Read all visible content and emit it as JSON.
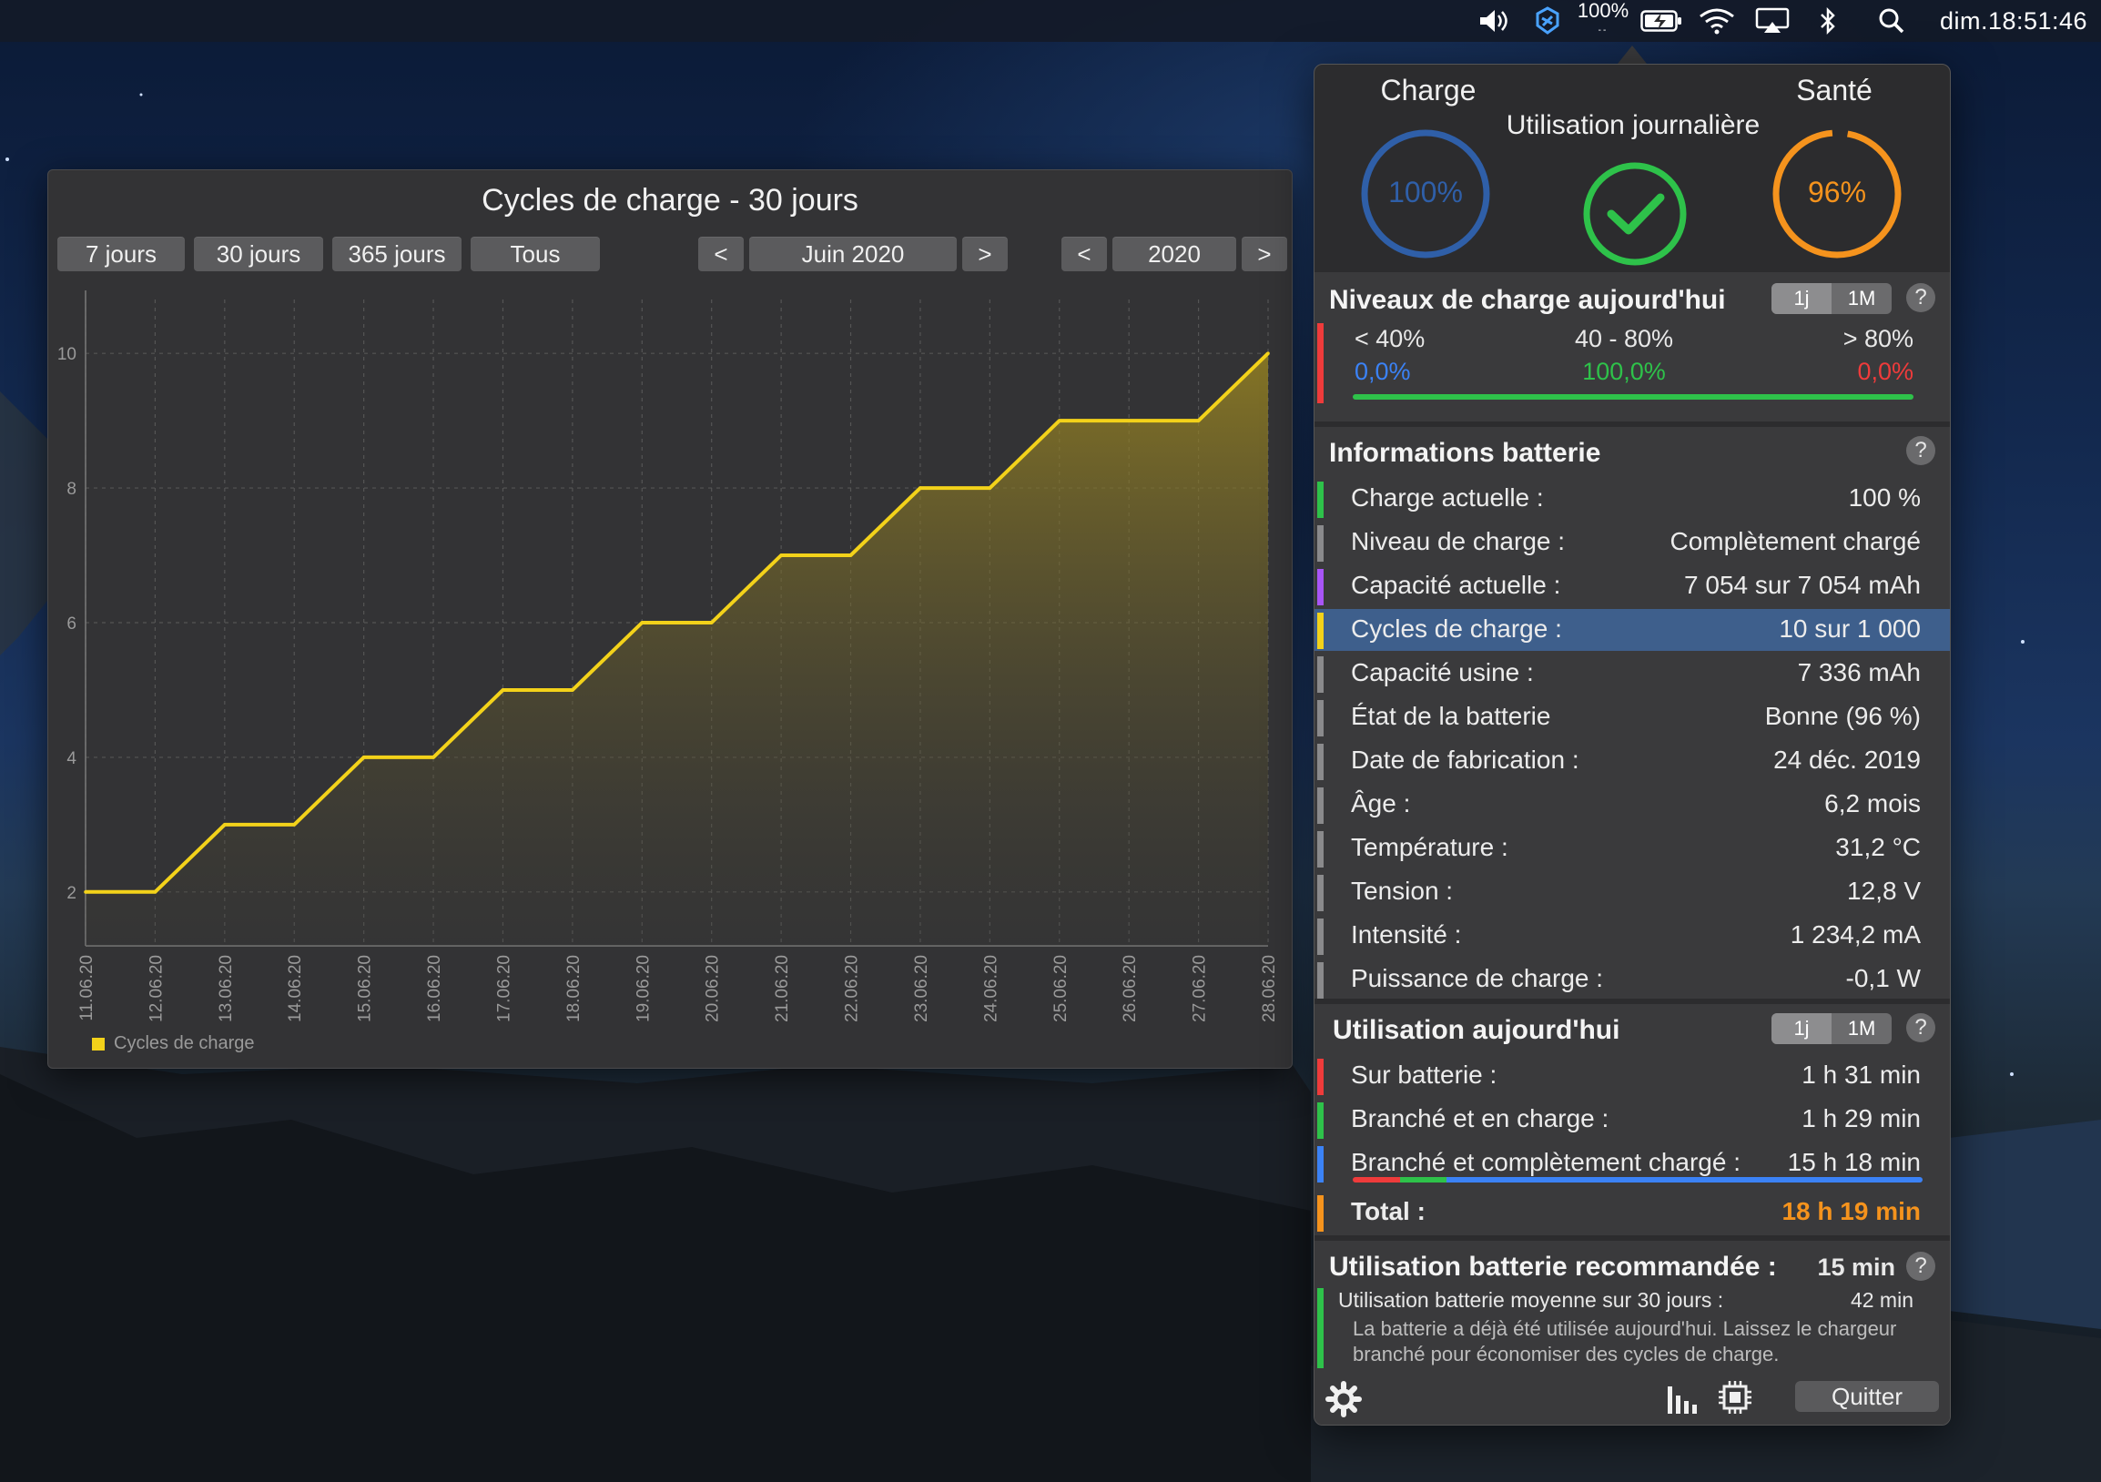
{
  "menubar": {
    "battery_percent": "100%",
    "clock": "dim.18:51:46",
    "icons": [
      "volume-icon",
      "app-status-icon",
      "battery-charging-icon",
      "wifi-icon",
      "airplay-icon",
      "bluetooth-icon",
      "spotlight-search-icon"
    ]
  },
  "chart_window": {
    "title": "Cycles de charge - 30 jours",
    "range_buttons": [
      "7 jours",
      "30 jours",
      "365 jours",
      "Tous"
    ],
    "month_nav": {
      "prev": "<",
      "label": "Juin 2020",
      "next": ">"
    },
    "year_nav": {
      "prev": "<",
      "label": "2020",
      "next": ">"
    }
  },
  "chart_data": {
    "type": "area",
    "title": "Cycles de charge - 30 jours",
    "x": [
      "11.06.20",
      "12.06.20",
      "13.06.20",
      "14.06.20",
      "15.06.20",
      "16.06.20",
      "17.06.20",
      "18.06.20",
      "19.06.20",
      "20.06.20",
      "21.06.20",
      "22.06.20",
      "23.06.20",
      "24.06.20",
      "25.06.20",
      "26.06.20",
      "27.06.20",
      "28.06.20"
    ],
    "series": [
      {
        "name": "Cycles de charge",
        "values": [
          2,
          2,
          3,
          3,
          4,
          4,
          5,
          5,
          6,
          6,
          7,
          7,
          8,
          8,
          9,
          9,
          9,
          10
        ],
        "color": "#f3d21a"
      }
    ],
    "yticks": [
      2,
      4,
      6,
      8,
      10
    ],
    "ylim": [
      1.2,
      10.8
    ],
    "grid": true,
    "legend": "bottom-left"
  },
  "popover": {
    "gauges": {
      "charge": {
        "title": "Charge",
        "value": "100%",
        "color": "#2f5fa8"
      },
      "daily": {
        "title": "Utilisation journalière",
        "color": "#2ec24a"
      },
      "health": {
        "title": "Santé",
        "value": "96%",
        "color": "#f5931d"
      }
    },
    "levels": {
      "title": "Niveaux de charge aujourd'hui",
      "toggle": [
        "1j",
        "1M"
      ],
      "help": "?",
      "columns": [
        {
          "label": "< 40%",
          "value": "0,0%",
          "color": "#3b82f6"
        },
        {
          "label": "40 - 80%",
          "value": "100,0%",
          "color": "#2ec24a"
        },
        {
          "label": "> 80%",
          "value": "0,0%",
          "color": "#ef3b3b"
        }
      ]
    },
    "info": {
      "title": "Informations batterie",
      "help": "?",
      "rows": [
        {
          "label": "Charge actuelle :",
          "value": "100 %",
          "color": "#2ec24a"
        },
        {
          "label": "Niveau de charge :",
          "value": "Complètement chargé",
          "color": "#8a8a8c"
        },
        {
          "label": "Capacité actuelle :",
          "value": "7 054 sur 7 054 mAh",
          "color": "#a855f7"
        },
        {
          "label": "Cycles de charge :",
          "value": "10 sur 1 000",
          "color": "#f3d21a"
        },
        {
          "label": "Capacité usine :",
          "value": "7 336 mAh",
          "color": "#8a8a8c"
        },
        {
          "label": "État de la batterie",
          "value": "Bonne (96 %)",
          "color": "#8a8a8c"
        },
        {
          "label": "Date de fabrication :",
          "value": "24 déc. 2019",
          "color": "#8a8a8c"
        },
        {
          "label": "Âge :",
          "value": "6,2 mois",
          "color": "#8a8a8c"
        },
        {
          "label": "Température :",
          "value": "31,2 °C",
          "color": "#8a8a8c"
        },
        {
          "label": "Tension :",
          "value": "12,8 V",
          "color": "#8a8a8c"
        },
        {
          "label": "Intensité :",
          "value": "1 234,2 mA",
          "color": "#8a8a8c"
        },
        {
          "label": "Puissance de charge :",
          "value": "-0,1 W",
          "color": "#8a8a8c"
        }
      ]
    },
    "usage": {
      "title": "Utilisation aujourd'hui",
      "toggle": [
        "1j",
        "1M"
      ],
      "help": "?",
      "rows": [
        {
          "label": "Sur batterie :",
          "value": "1 h 31 min",
          "color": "#ef3b3b"
        },
        {
          "label": "Branché et en charge :",
          "value": "1 h 29 min",
          "color": "#2ec24a"
        },
        {
          "label": "Branché et complètement chargé :",
          "value": "15 h 18 min",
          "color": "#3b82f6"
        }
      ],
      "total_label": "Total :",
      "total_value": "18 h 19 min",
      "total_color": "#f5931d"
    },
    "recommended": {
      "title": "Utilisation batterie recommandée :",
      "value": "15 min",
      "help": "?",
      "avg_label": "Utilisation batterie moyenne sur 30 jours :",
      "avg_value": "42 min",
      "note_line1": "La batterie a déjà été utilisée aujourd'hui. Laissez le chargeur",
      "note_line2": "branché pour économiser des cycles de charge."
    },
    "footer": {
      "quit": "Quitter",
      "icons": [
        "settings-gear-icon",
        "bar-chart-icon",
        "chip-icon"
      ]
    }
  }
}
